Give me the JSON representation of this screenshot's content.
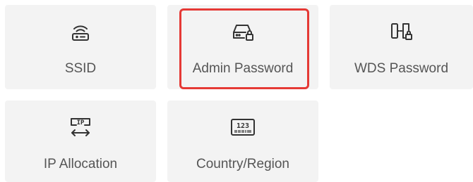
{
  "tiles": [
    {
      "label": "SSID",
      "icon": "router-icon"
    },
    {
      "label": "Admin Password",
      "icon": "device-lock-icon"
    },
    {
      "label": "WDS Password",
      "icon": "wds-lock-icon"
    },
    {
      "label": "IP Allocation",
      "icon": "ip-allocation-icon"
    },
    {
      "label": "Country/Region",
      "icon": "region-code-icon"
    }
  ],
  "colors": {
    "tile_bg": "#f3f3f3",
    "highlight": "#e53935",
    "icon": "#333333",
    "label": "#555555"
  },
  "region_icon_text": "123",
  "ip_icon_text": "IP"
}
